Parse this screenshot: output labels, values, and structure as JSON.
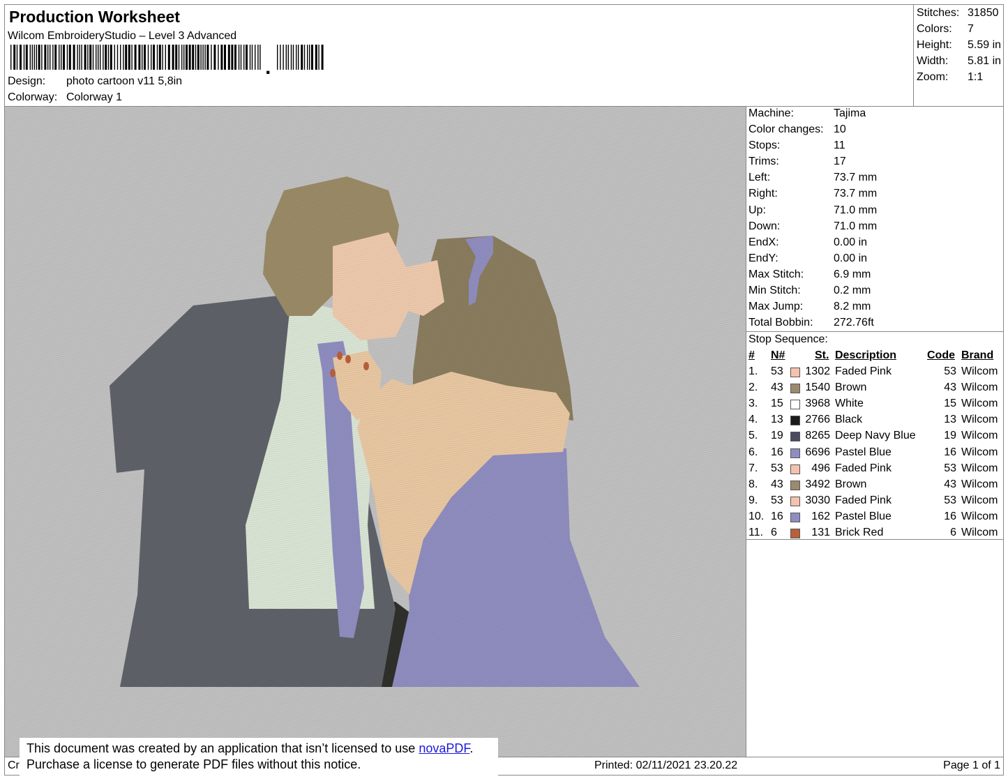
{
  "header": {
    "title": "Production Worksheet",
    "software": "Wilcom EmbroideryStudio – Level 3 Advanced",
    "barcode_suffix": ",",
    "design_label": "Design:",
    "design_value": "photo cartoon v11 5,8in",
    "colorway_label": "Colorway:",
    "colorway_value": "Colorway 1"
  },
  "stats": [
    {
      "label": "Stitches:",
      "value": "31850"
    },
    {
      "label": "Colors:",
      "value": "7"
    },
    {
      "label": "Height:",
      "value": "5.59 in"
    },
    {
      "label": "Width:",
      "value": "5.81 in"
    },
    {
      "label": "Zoom:",
      "value": "1:1"
    }
  ],
  "machine_info": [
    {
      "label": "Machine:",
      "value": "Tajima"
    },
    {
      "label": "Color changes:",
      "value": "10"
    },
    {
      "label": "Stops:",
      "value": "11"
    },
    {
      "label": "Trims:",
      "value": "17"
    },
    {
      "label": "Left:",
      "value": "73.7 mm"
    },
    {
      "label": "Right:",
      "value": "73.7 mm"
    },
    {
      "label": "Up:",
      "value": "71.0 mm"
    },
    {
      "label": "Down:",
      "value": "71.0 mm"
    },
    {
      "label": "EndX:",
      "value": "0.00 in"
    },
    {
      "label": "EndY:",
      "value": "0.00 in"
    },
    {
      "label": "Max Stitch:",
      "value": "6.9 mm"
    },
    {
      "label": "Min Stitch:",
      "value": "0.2 mm"
    },
    {
      "label": "Max Jump:",
      "value": "8.2 mm"
    },
    {
      "label": "Total Bobbin:",
      "value": "272.76ft"
    }
  ],
  "stop_sequence": {
    "title": "Stop Sequence:",
    "headers": {
      "num": "#",
      "n": "N#",
      "st": "St.",
      "description": "Description",
      "code": "Code",
      "brand": "Brand"
    },
    "rows": [
      {
        "num": "1.",
        "n": "53",
        "color": "#f4c3ae",
        "st": "1302",
        "description": "Faded Pink",
        "code": "53",
        "brand": "Wilcom"
      },
      {
        "num": "2.",
        "n": "43",
        "color": "#9c8a6e",
        "st": "1540",
        "description": "Brown",
        "code": "43",
        "brand": "Wilcom"
      },
      {
        "num": "3.",
        "n": "15",
        "color": "#ffffff",
        "st": "3968",
        "description": "White",
        "code": "15",
        "brand": "Wilcom"
      },
      {
        "num": "4.",
        "n": "13",
        "color": "#1a1a1a",
        "st": "2766",
        "description": "Black",
        "code": "13",
        "brand": "Wilcom"
      },
      {
        "num": "5.",
        "n": "19",
        "color": "#4a4a60",
        "st": "8265",
        "description": "Deep Navy Blue",
        "code": "19",
        "brand": "Wilcom"
      },
      {
        "num": "6.",
        "n": "16",
        "color": "#8f8dbf",
        "st": "6696",
        "description": "Pastel Blue",
        "code": "16",
        "brand": "Wilcom"
      },
      {
        "num": "7.",
        "n": "53",
        "color": "#f4c3ae",
        "st": "496",
        "description": "Faded Pink",
        "code": "53",
        "brand": "Wilcom"
      },
      {
        "num": "8.",
        "n": "43",
        "color": "#9c8a6e",
        "st": "3492",
        "description": "Brown",
        "code": "43",
        "brand": "Wilcom"
      },
      {
        "num": "9.",
        "n": "53",
        "color": "#f4c3ae",
        "st": "3030",
        "description": "Faded Pink",
        "code": "53",
        "brand": "Wilcom"
      },
      {
        "num": "10.",
        "n": "16",
        "color": "#8f8dbf",
        "st": "162",
        "description": "Pastel Blue",
        "code": "16",
        "brand": "Wilcom"
      },
      {
        "num": "11.",
        "n": "6",
        "color": "#b8603a",
        "st": "131",
        "description": "Brick Red",
        "code": "6",
        "brand": "Wilcom"
      }
    ]
  },
  "footer": {
    "cr": "Cr",
    "printed": "Printed: 02/11/2021 23.20.22",
    "page": "Page 1 of 1"
  },
  "notice": {
    "line1_prefix": "This document was created by an application that isn’t licensed to use ",
    "link": "novaPDF",
    "line1_suffix": ".",
    "line2": "Purchase a license to generate PDF files without this notice."
  },
  "colors": {
    "preview_bg": "#c0c0c0",
    "link": "#1a1adb"
  }
}
